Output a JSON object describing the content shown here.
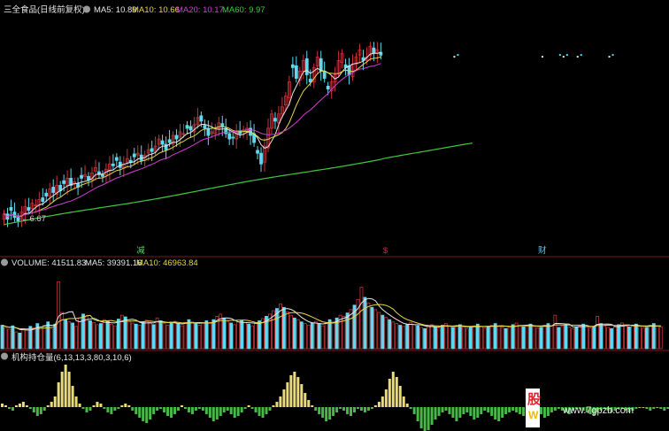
{
  "colors": {
    "up": "#c8323a",
    "down": "#5fd8f0",
    "ma5": "#e6e6e6",
    "ma10": "#e8d64a",
    "ma20": "#d040d0",
    "ma60": "#40c840",
    "separator": "#7a1a1a",
    "hist_pos": "#e8dc78",
    "hist_neg": "#48b848",
    "event_red": "#e8202a",
    "event_green": "#50d050"
  },
  "price_panel": {
    "title": "三全食品(日线前复权)",
    "ma_labels": [
      {
        "name": "MA5",
        "value": "10.89",
        "text": "MA5: 10.89",
        "color": "#e6e6e6"
      },
      {
        "name": "MA10",
        "value": "10.66",
        "text": "MA10: 10.66",
        "color": "#e8d64a"
      },
      {
        "name": "MA20",
        "value": "10.17",
        "text": "MA20: 10.17",
        "color": "#d040d0"
      },
      {
        "name": "MA60",
        "value": "9.97",
        "text": "MA60: 9.97",
        "color": "#40c840"
      }
    ],
    "low_marker": "←6.67",
    "events": [
      {
        "label": "减",
        "color": "#50d050",
        "index": 38
      },
      {
        "label": "$",
        "color": "#e8202a",
        "index": 108
      },
      {
        "label": "财",
        "color": "#5fb8f0",
        "index": 152
      }
    ]
  },
  "volume_panel": {
    "title": "VOLUME: 41511.83",
    "ma_labels": [
      {
        "text": "MA5: 39391.16",
        "color": "#e6e6e6"
      },
      {
        "text": "MA10: 46963.84",
        "color": "#e8d64a"
      }
    ]
  },
  "indicator_panel": {
    "title": "机构持仓量(6,13,13,3,80,3,10,6)"
  },
  "watermark": {
    "char1": "股",
    "char2": "W",
    "site": "www.7gpzb.com"
  },
  "chart_data": {
    "type": "candlestick",
    "bars": 190,
    "price_range": [
      6.2,
      12.6
    ],
    "price_closes": [
      7.2,
      7.05,
      7.3,
      7.1,
      7.0,
      7.25,
      7.4,
      7.3,
      7.5,
      7.45,
      7.6,
      7.55,
      7.7,
      7.9,
      7.8,
      8.0,
      7.85,
      8.05,
      8.2,
      8.0,
      8.1,
      7.95,
      8.2,
      8.3,
      8.15,
      8.35,
      8.5,
      8.3,
      8.25,
      8.45,
      8.6,
      8.55,
      8.7,
      8.5,
      8.6,
      8.75,
      8.65,
      8.8,
      8.9,
      8.7,
      8.85,
      9.0,
      8.95,
      9.1,
      9.3,
      9.15,
      9.0,
      9.2,
      9.4,
      9.3,
      9.5,
      9.45,
      9.6,
      9.55,
      9.7,
      9.9,
      9.8,
      9.6,
      9.4,
      9.5,
      9.6,
      9.75,
      9.65,
      9.45,
      9.3,
      9.35,
      9.5,
      9.45,
      9.55,
      9.6,
      9.4,
      9.2,
      8.9,
      8.6,
      9.1,
      9.6,
      10.0,
      9.8,
      10.0,
      10.2,
      10.5,
      10.9,
      11.3,
      11.0,
      11.2,
      11.5,
      11.1,
      10.9,
      11.3,
      11.6,
      11.2,
      11.0,
      10.7,
      10.9,
      11.1,
      11.5,
      11.7,
      11.3,
      11.1,
      11.4,
      11.6,
      11.8,
      11.5,
      11.6,
      11.9,
      11.7,
      11.8,
      11.65
    ],
    "volume_range": [
      0,
      130000
    ],
    "volumes": [
      42000,
      38000,
      35000,
      41000,
      30000,
      28000,
      36000,
      33000,
      40000,
      37000,
      45000,
      39000,
      42000,
      48000,
      36000,
      44000,
      120000,
      65000,
      52000,
      48000,
      46000,
      40000,
      55000,
      62000,
      58000,
      50000,
      47000,
      43000,
      45000,
      52000,
      49000,
      44000,
      41000,
      53000,
      60000,
      57000,
      49000,
      46000,
      44000,
      42000,
      48000,
      51000,
      47000,
      43000,
      55000,
      50000,
      45000,
      42000,
      46000,
      49000,
      44000,
      41000,
      47000,
      52000,
      48000,
      45000,
      42000,
      46000,
      50000,
      47000,
      52000,
      58000,
      62000,
      55000,
      49000,
      46000,
      43000,
      48000,
      51000,
      47000,
      44000,
      41000,
      45000,
      50000,
      54000,
      58000,
      62000,
      68000,
      72000,
      80000,
      74000,
      66000,
      60000,
      55000,
      52000,
      48000,
      45000,
      42000,
      46000,
      49000,
      44000,
      41000,
      47000,
      52000,
      48000,
      55000,
      60000,
      58000,
      64000,
      70000,
      78000,
      88000,
      110000,
      92000,
      82000,
      74000,
      70000,
      65000,
      60000,
      56000,
      52000,
      48000,
      45000,
      42000,
      40000,
      44000,
      47000,
      43000,
      41000,
      38000,
      36000,
      40000,
      43000,
      39000,
      37000,
      42000,
      45000,
      41000,
      38000,
      40000,
      43000,
      39000,
      36000,
      38000,
      41000,
      44000,
      40000,
      37000,
      39000,
      42000,
      45000,
      41000,
      38000,
      36000,
      39000,
      43000,
      46000,
      42000,
      39000,
      41000,
      44000,
      40000,
      37000,
      38000,
      42000,
      45000,
      41000,
      60000,
      38000,
      40000,
      43000,
      39000,
      36000,
      38000,
      41000,
      44000,
      40000,
      37000,
      39000,
      58000,
      45000,
      41000,
      38000,
      36000,
      39000,
      43000,
      46000,
      42000,
      39000,
      41000,
      44000,
      40000,
      37000,
      38000,
      42000,
      45000,
      41000,
      39000
    ],
    "indicator_values": [
      2,
      1,
      -1,
      -2,
      1,
      2,
      3,
      1,
      -1,
      -3,
      -5,
      -4,
      -2,
      1,
      3,
      6,
      14,
      20,
      24,
      20,
      12,
      6,
      2,
      -1,
      -3,
      -2,
      1,
      3,
      2,
      -1,
      -3,
      -4,
      -2,
      -1,
      1,
      2,
      1,
      -2,
      -4,
      -6,
      -8,
      -9,
      -7,
      -4,
      -2,
      -1,
      -3,
      -5,
      -6,
      -4,
      -2,
      1,
      -1,
      -3,
      -4,
      -2,
      -1,
      -2,
      -4,
      -6,
      -8,
      -7,
      -5,
      -3,
      -2,
      -4,
      -6,
      -5,
      -3,
      -1,
      1,
      -1,
      -3,
      -5,
      -6,
      -4,
      -2,
      1,
      3,
      6,
      10,
      14,
      18,
      20,
      17,
      13,
      8,
      4,
      1,
      -2,
      -4,
      -6,
      -8,
      -7,
      -5,
      -3,
      -1,
      -2,
      -4,
      -5,
      -3,
      -1,
      -2,
      -3,
      -2,
      -1,
      1,
      3,
      6,
      10,
      16,
      20,
      17,
      12,
      6,
      2,
      -1,
      -4,
      -8,
      -12,
      -14,
      -13,
      -10,
      -7,
      -5,
      -3,
      -2,
      -4,
      -6,
      -8,
      -6,
      -4,
      -3,
      -5,
      -7,
      -6,
      -4,
      -2,
      -3,
      -5,
      -7,
      -8,
      -6,
      -4,
      -3,
      -2,
      -3,
      -4,
      -5,
      -3,
      -2,
      -1,
      -2,
      -4,
      -6,
      -5,
      -3,
      -2,
      -1,
      -2,
      -3,
      -4,
      -2,
      -1,
      -1,
      -2,
      -3,
      -4,
      -5,
      -3,
      -2,
      -1,
      -2,
      -3,
      -2,
      -1,
      -1,
      -2,
      -3,
      -2,
      -1,
      0,
      0,
      -1,
      -2,
      -1,
      0,
      -1,
      -2,
      -1,
      0,
      0,
      -1
    ]
  }
}
